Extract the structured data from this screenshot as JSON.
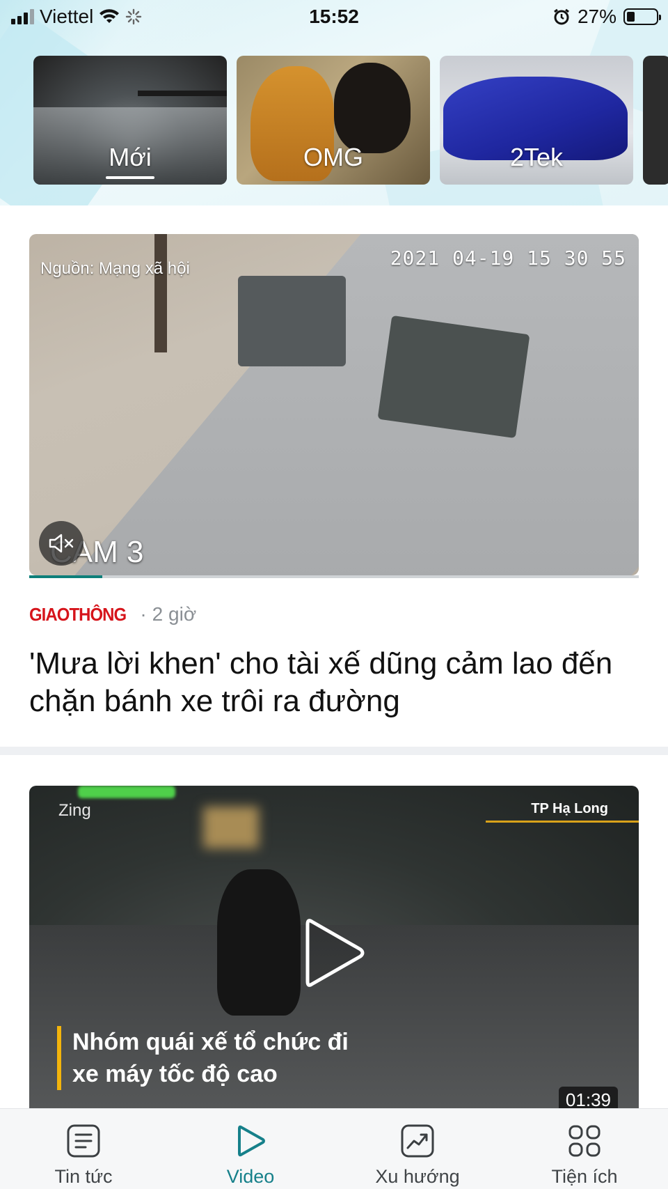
{
  "status_bar": {
    "carrier": "Viettel",
    "time": "15:52",
    "battery": "27%"
  },
  "categories": [
    {
      "label": "Mới",
      "selected": true
    },
    {
      "label": "OMG",
      "selected": false
    },
    {
      "label": "2Tek",
      "selected": false
    }
  ],
  "stories": [
    {
      "video_source_overlay": "Nguồn: Mạng xã hội",
      "video_timestamp": "2021 04-19 15 30 55",
      "video_cam_label": "CAM 3",
      "progress": 0.12,
      "publisher": "GIAOTHÔNG",
      "separator": "·",
      "age": "2 giờ",
      "headline": "'Mưa lời khen' cho tài xế dũng cảm lao đến chặn bánh xe trôi ra đường"
    },
    {
      "video_source_overlay": "Zing",
      "video_location": "TP Hạ Long",
      "caption": "Nhóm quái xế tổ chức đi xe máy tốc độ cao",
      "duration": "01:39"
    }
  ],
  "tabs": [
    {
      "label": "Tin tức",
      "icon": "news-icon",
      "active": false
    },
    {
      "label": "Video",
      "icon": "play-icon",
      "active": true
    },
    {
      "label": "Xu hướng",
      "icon": "trending-icon",
      "active": false
    },
    {
      "label": "Tiện ích",
      "icon": "grid-icon",
      "active": false
    }
  ],
  "colors": {
    "accent": "#16808a",
    "publisher_red": "#d6141b",
    "caption_bar": "#f3b40c"
  }
}
